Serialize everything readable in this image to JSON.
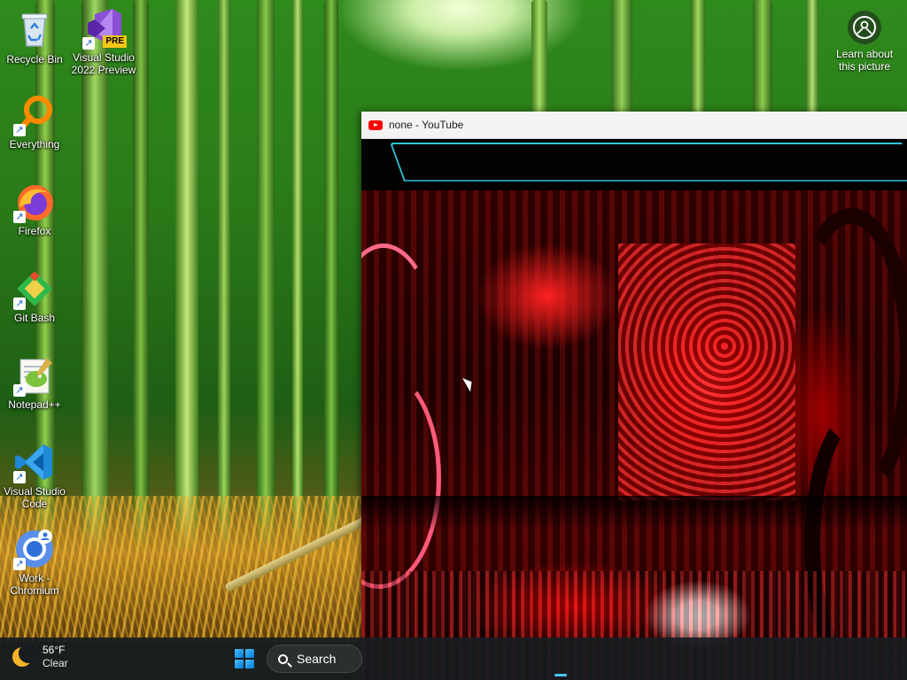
{
  "desktop": {
    "icons": [
      {
        "label": "Recycle Bin",
        "icon": "recycle-bin-icon"
      },
      {
        "label": "Visual Studio 2022 Preview",
        "badge": "PRE",
        "icon": "visual-studio-preview-icon"
      },
      {
        "label": "Everything",
        "icon": "everything-search-icon"
      },
      {
        "label": "Firefox",
        "icon": "firefox-icon"
      },
      {
        "label": "Git Bash",
        "icon": "git-bash-icon"
      },
      {
        "label": "Notepad++",
        "icon": "notepad-plus-plus-icon"
      },
      {
        "label": "Visual Studio Code",
        "icon": "vscode-icon"
      },
      {
        "label": "Work - Chromium",
        "icon": "chromium-profile-icon"
      }
    ],
    "learn_about_picture": "Learn about this picture"
  },
  "window": {
    "title": "none - YouTube",
    "icon": "youtube-icon"
  },
  "taskbar": {
    "weather": {
      "temp": "56°F",
      "condition": "Clear"
    },
    "search_label": "Search"
  },
  "colors": {
    "accent": "#4cc2ff",
    "youtube_red": "#ff0000",
    "taskbar_bg": "#181c20"
  }
}
